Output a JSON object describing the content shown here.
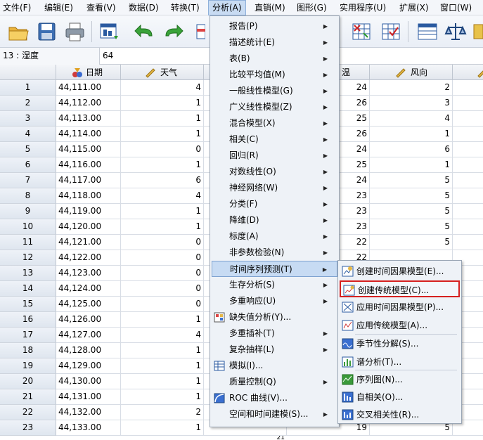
{
  "menubar": {
    "items": [
      {
        "label": "文件(F)"
      },
      {
        "label": "编辑(E)"
      },
      {
        "label": "查看(V)"
      },
      {
        "label": "数据(D)"
      },
      {
        "label": "转换(T)"
      },
      {
        "label": "分析(A)"
      },
      {
        "label": "直销(M)"
      },
      {
        "label": "图形(G)"
      },
      {
        "label": "实用程序(U)"
      },
      {
        "label": "扩展(X)"
      },
      {
        "label": "窗口(W)"
      }
    ]
  },
  "editor": {
    "cell_ref": "13 : 湿度",
    "cell_value": "64"
  },
  "grid": {
    "columns": [
      {
        "label": "日期",
        "icon": "calendar-ruler-icon"
      },
      {
        "label": "天气",
        "icon": "pencil-ruler-icon"
      },
      {
        "label": "温",
        "icon": ""
      },
      {
        "label": "风向",
        "icon": "pencil-ruler-icon"
      }
    ],
    "rows": [
      {
        "n": "1",
        "date": "44,111.00",
        "weather": "4",
        "temp": "24",
        "wind": "2"
      },
      {
        "n": "2",
        "date": "44,112.00",
        "weather": "1",
        "temp": "26",
        "wind": "3"
      },
      {
        "n": "3",
        "date": "44,113.00",
        "weather": "1",
        "temp": "25",
        "wind": "4"
      },
      {
        "n": "4",
        "date": "44,114.00",
        "weather": "1",
        "temp": "26",
        "wind": "1"
      },
      {
        "n": "5",
        "date": "44,115.00",
        "weather": "0",
        "temp": "24",
        "wind": "6"
      },
      {
        "n": "6",
        "date": "44,116.00",
        "weather": "1",
        "temp": "25",
        "wind": "1"
      },
      {
        "n": "7",
        "date": "44,117.00",
        "weather": "6",
        "temp": "24",
        "wind": "5"
      },
      {
        "n": "8",
        "date": "44,118.00",
        "weather": "4",
        "temp": "23",
        "wind": "5"
      },
      {
        "n": "9",
        "date": "44,119.00",
        "weather": "1",
        "temp": "23",
        "wind": "5"
      },
      {
        "n": "10",
        "date": "44,120.00",
        "weather": "1",
        "temp": "23",
        "wind": "5"
      },
      {
        "n": "11",
        "date": "44,121.00",
        "weather": "0",
        "temp": "22",
        "wind": "5"
      },
      {
        "n": "12",
        "date": "44,122.00",
        "weather": "0",
        "temp": "22",
        "wind": ""
      },
      {
        "n": "13",
        "date": "44,123.00",
        "weather": "0",
        "temp": "",
        "wind": ""
      },
      {
        "n": "14",
        "date": "44,124.00",
        "weather": "0",
        "temp": "",
        "wind": ""
      },
      {
        "n": "15",
        "date": "44,125.00",
        "weather": "0",
        "temp": "",
        "wind": ""
      },
      {
        "n": "16",
        "date": "44,126.00",
        "weather": "1",
        "temp": "",
        "wind": ""
      },
      {
        "n": "17",
        "date": "44,127.00",
        "weather": "4",
        "temp": "",
        "wind": ""
      },
      {
        "n": "18",
        "date": "44,128.00",
        "weather": "1",
        "temp": "",
        "wind": ""
      },
      {
        "n": "19",
        "date": "44,129.00",
        "weather": "1",
        "temp": "",
        "wind": ""
      },
      {
        "n": "20",
        "date": "44,130.00",
        "weather": "1",
        "temp": "",
        "wind": ""
      },
      {
        "n": "21",
        "date": "44,131.00",
        "weather": "1",
        "temp": "",
        "wind": ""
      },
      {
        "n": "22",
        "date": "44,132.00",
        "weather": "2",
        "temp": "",
        "wind": ""
      },
      {
        "n": "23",
        "date": "44,133.00",
        "weather": "1",
        "temp": "19",
        "wind": "5"
      }
    ],
    "extra_peek": "21"
  },
  "analyze_menu": {
    "items": [
      {
        "label": "报告(P)",
        "submenu": true
      },
      {
        "label": "描述统计(E)",
        "submenu": true
      },
      {
        "label": "表(B)",
        "submenu": true
      },
      {
        "label": "比较平均值(M)",
        "submenu": true
      },
      {
        "label": "一般线性模型(G)",
        "submenu": true
      },
      {
        "label": "广义线性模型(Z)",
        "submenu": true
      },
      {
        "label": "混合模型(X)",
        "submenu": true
      },
      {
        "label": "相关(C)",
        "submenu": true
      },
      {
        "label": "回归(R)",
        "submenu": true
      },
      {
        "label": "对数线性(O)",
        "submenu": true
      },
      {
        "label": "神经网络(W)",
        "submenu": true
      },
      {
        "label": "分类(F)",
        "submenu": true
      },
      {
        "label": "降维(D)",
        "submenu": true
      },
      {
        "label": "标度(A)",
        "submenu": true
      },
      {
        "label": "非参数检验(N)",
        "submenu": true
      },
      {
        "label": "时间序列预测(T)",
        "submenu": true,
        "highlight": true
      },
      {
        "label": "生存分析(S)",
        "submenu": true
      },
      {
        "label": "多重响应(U)",
        "submenu": true
      },
      {
        "label": "缺失值分析(Y)...",
        "submenu": false,
        "icon": "missing-values-icon"
      },
      {
        "label": "多重插补(T)",
        "submenu": true
      },
      {
        "label": "复杂抽样(L)",
        "submenu": true
      },
      {
        "label": "模拟(I)...",
        "submenu": false,
        "icon": "simulation-icon"
      },
      {
        "label": "质量控制(Q)",
        "submenu": true
      },
      {
        "label": "ROC 曲线(V)...",
        "submenu": false,
        "icon": "roc-curve-icon"
      },
      {
        "label": "空间和时间建模(S)...",
        "submenu": true
      }
    ]
  },
  "timeseries_submenu": {
    "items": [
      {
        "label": "创建时间因果模型(E)...",
        "icon": "temporal-causal-create-icon"
      },
      {
        "label": "创建传统模型(C)...",
        "icon": "traditional-model-create-icon",
        "selected": true
      },
      {
        "label": "应用时间因果模型(P)...",
        "icon": "temporal-causal-apply-icon"
      },
      {
        "label": "应用传统模型(A)...",
        "icon": "traditional-model-apply-icon"
      },
      {
        "label": "季节性分解(S)...",
        "icon": "seasonal-decomposition-icon"
      },
      {
        "label": "谱分析(T)...",
        "icon": "spectral-analysis-icon"
      },
      {
        "label": "序列图(N)...",
        "icon": "sequence-chart-icon"
      },
      {
        "label": "自相关(O)...",
        "icon": "autocorrelation-icon"
      },
      {
        "label": "交叉相关性(R)...",
        "icon": "cross-correlation-icon"
      }
    ]
  },
  "colors": {
    "highlight": "#c7dbf3",
    "selected_border": "#d62020",
    "menu_bg": "#eef2f7"
  }
}
